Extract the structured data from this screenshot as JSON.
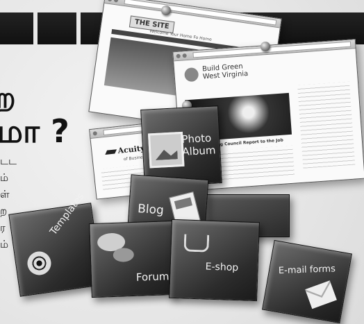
{
  "heading": {
    "line1": "ற",
    "line2": "மா ?"
  },
  "margin_text": [
    "டட",
    "ம்",
    "ள்",
    "ற",
    "ர",
    "ம்"
  ],
  "windows": {
    "top": {
      "site_title": "THE SITE",
      "tagline": "Welcome Your Home Fo Home"
    },
    "blog": {
      "brand_line1": "Build Green",
      "brand_line2": "West Virginia",
      "post_title": "Green Building Council Report to the Job"
    },
    "small": {
      "logo": "Acuity",
      "subtitle": "of Business"
    }
  },
  "cubes": {
    "photo_album": "Photo Album",
    "blog": "Blog",
    "templates": "Templates",
    "forum": "Forum",
    "eshop": "E-shop",
    "email_forms": "E-mail forms"
  }
}
